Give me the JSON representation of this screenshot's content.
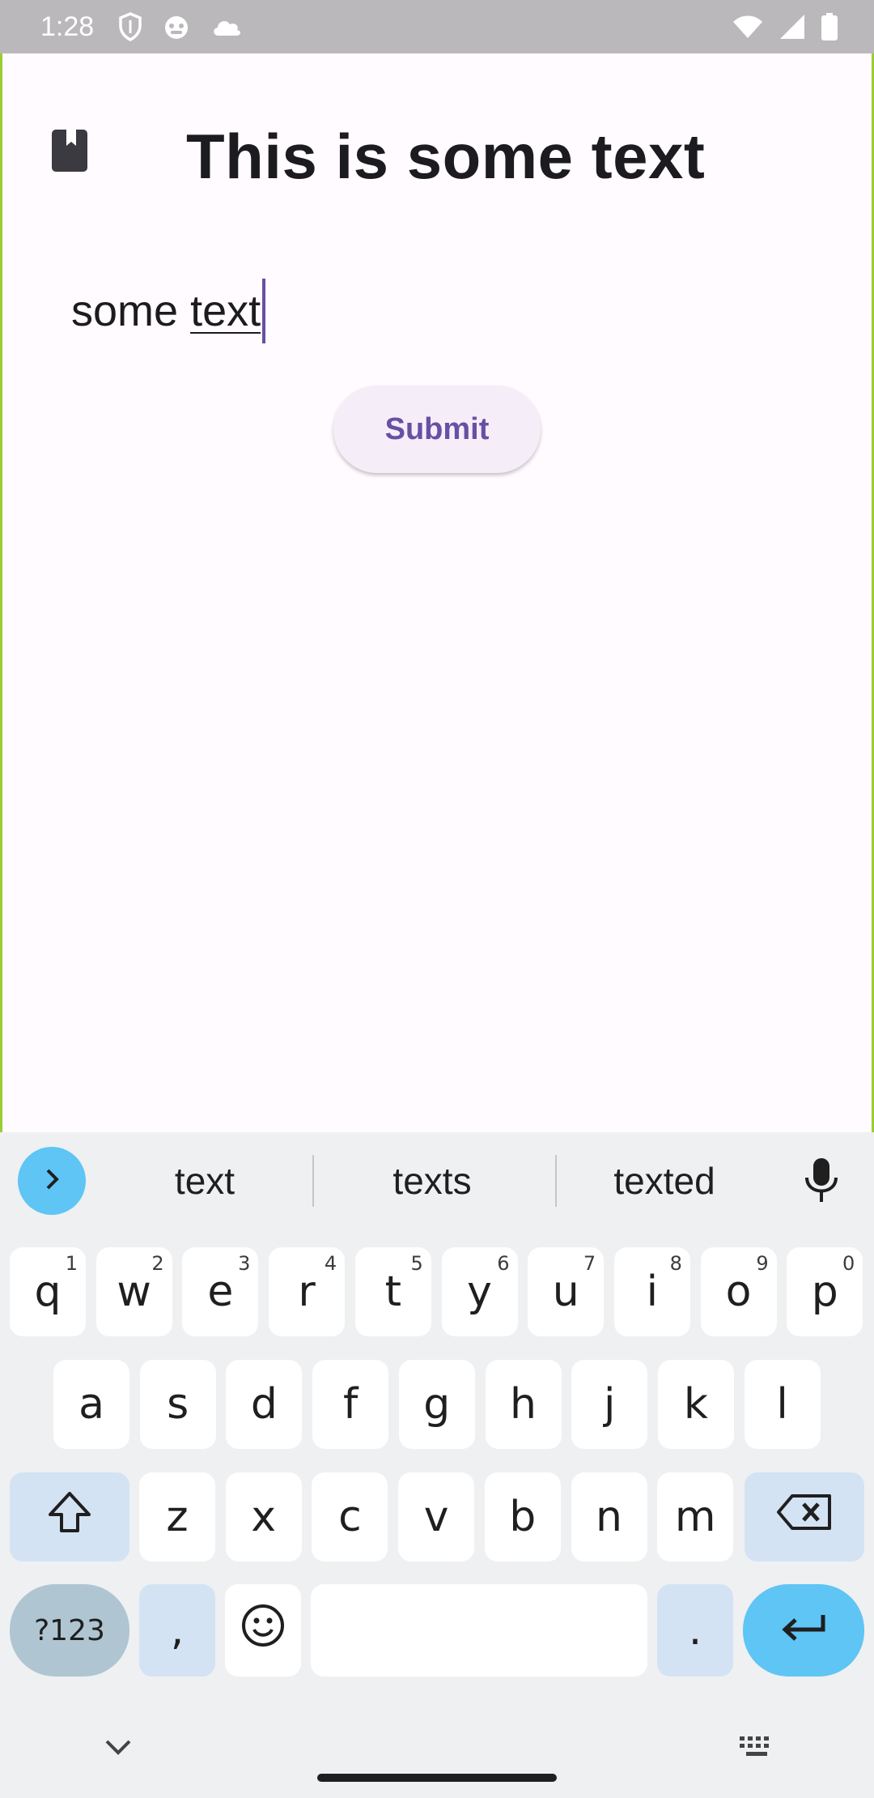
{
  "status_bar": {
    "time": "1:28",
    "left_icons": [
      "shield-icon",
      "cat-face-icon",
      "cloud-icon"
    ],
    "right_icons": [
      "wifi-icon",
      "signal-icon",
      "battery-icon"
    ]
  },
  "app": {
    "title": "This is some text",
    "input": {
      "committed_text": "some ",
      "composing_text": "text"
    },
    "submit_label": "Submit",
    "accent_color": "#6750a4"
  },
  "keyboard": {
    "suggestions": [
      "text",
      "texts",
      "texted"
    ],
    "row1": [
      {
        "k": "q",
        "h": "1"
      },
      {
        "k": "w",
        "h": "2"
      },
      {
        "k": "e",
        "h": "3"
      },
      {
        "k": "r",
        "h": "4"
      },
      {
        "k": "t",
        "h": "5"
      },
      {
        "k": "y",
        "h": "6"
      },
      {
        "k": "u",
        "h": "7"
      },
      {
        "k": "i",
        "h": "8"
      },
      {
        "k": "o",
        "h": "9"
      },
      {
        "k": "p",
        "h": "0"
      }
    ],
    "row2": [
      "a",
      "s",
      "d",
      "f",
      "g",
      "h",
      "j",
      "k",
      "l"
    ],
    "row3": [
      "z",
      "x",
      "c",
      "v",
      "b",
      "n",
      "m"
    ],
    "symbols_label": "?123",
    "comma_label": ",",
    "period_label": "."
  }
}
